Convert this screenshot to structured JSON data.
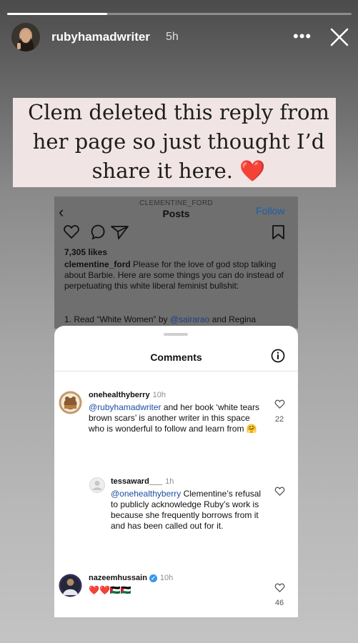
{
  "story": {
    "progress": 0.29,
    "username": "rubyhamadwriter",
    "time": "5h",
    "more_label": "•••",
    "caption": "Clem deleted this reply from her page so just thought I’d share it here. ❤️"
  },
  "post": {
    "back_label": "‹",
    "account": "CLEMENTINE_FORD",
    "title": "Posts",
    "follow_label": "Follow",
    "likes": "7,305 likes",
    "caption_user": "clementine_ford",
    "caption_text": " Please for the love of god stop talking about Barbie. Here are some things you can do instead of perpetuating this white liberal feminist bullshit:",
    "list_prefix": "1. Read “White Women” by ",
    "list_mention": "@sairarao",
    "list_suffix": " and Regina"
  },
  "comments_sheet": {
    "title": "Comments",
    "comments": [
      {
        "user": "onehealthyberry",
        "time": "10h",
        "mention": "@rubyhamadwriter",
        "text": " and her book ‘white tears brown scars’ is another writer in this space who is wonderful to follow and learn from 🤗",
        "likes": "22"
      },
      {
        "user": "tessaward___",
        "time": "1h",
        "mention": "@onehealthyberry",
        "text": " Clementine’s refusal to publicly acknowledge Ruby’s work is because she frequently borrows from it and has been called out for it.",
        "likes": ""
      },
      {
        "user": "nazeemhussain",
        "time": "10h",
        "verified": true,
        "mention": "",
        "text": "❤️❤️🇵🇸🇵🇸",
        "likes": "46"
      }
    ]
  },
  "colors": {
    "caption_bg": "#f1e4e4",
    "link": "#1b4fa0",
    "follow": "#1b5fa8",
    "verified": "#3897f0"
  },
  "icons": [
    "more-options-icon",
    "close-icon",
    "back-icon",
    "heart-icon",
    "comment-icon",
    "share-icon",
    "bookmark-icon",
    "info-icon",
    "verified-icon"
  ]
}
